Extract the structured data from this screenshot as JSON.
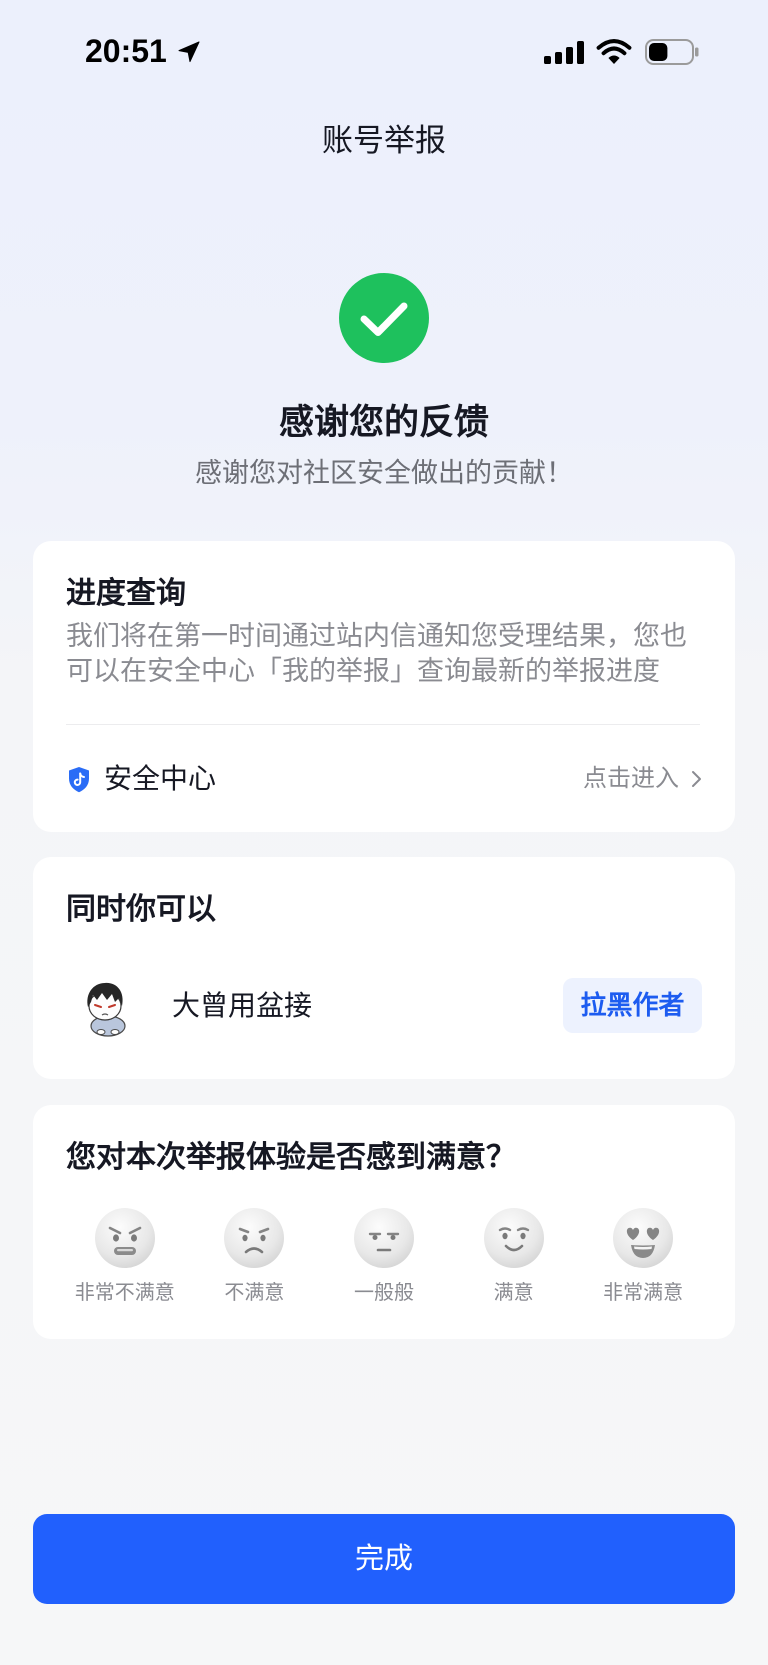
{
  "status_bar": {
    "time": "20:51",
    "location_icon": "location-arrow-icon",
    "signal_bars": 4,
    "wifi_icon": "wifi-icon",
    "battery_level": 0.45
  },
  "header": {
    "title": "账号举报"
  },
  "result": {
    "icon": "check-circle-icon",
    "title": "感谢您的反馈",
    "subtitle": "感谢您对社区安全做出的贡献！"
  },
  "progress_card": {
    "title": "进度查询",
    "description": "我们将在第一时间通过站内信通知您受理结果，您也可以在安全中心「我的举报」查询最新的举报进度",
    "security_center": {
      "icon": "shield-icon",
      "label": "安全中心",
      "link_label": "点击进入",
      "chevron_icon": "chevron-right-icon"
    }
  },
  "actions_card": {
    "title": "同时你可以",
    "author": {
      "avatar_icon": "user-avatar",
      "name": "大曾用盆接"
    },
    "block_button_label": "拉黑作者"
  },
  "survey_card": {
    "question": "您对本次举报体验是否感到满意？",
    "options": [
      {
        "label": "非常不满意",
        "icon": "very-dissatisfied-face-icon"
      },
      {
        "label": "不满意",
        "icon": "dissatisfied-face-icon"
      },
      {
        "label": "一般般",
        "icon": "neutral-face-icon"
      },
      {
        "label": "满意",
        "icon": "satisfied-face-icon"
      },
      {
        "label": "非常满意",
        "icon": "very-satisfied-face-icon"
      }
    ]
  },
  "footer": {
    "done_label": "完成"
  },
  "colors": {
    "accent": "#2160fd",
    "success": "#1ec15d",
    "block_button_bg": "#edf2fe",
    "block_button_text": "#1d5cf0",
    "shield": "#2a6cf6"
  }
}
